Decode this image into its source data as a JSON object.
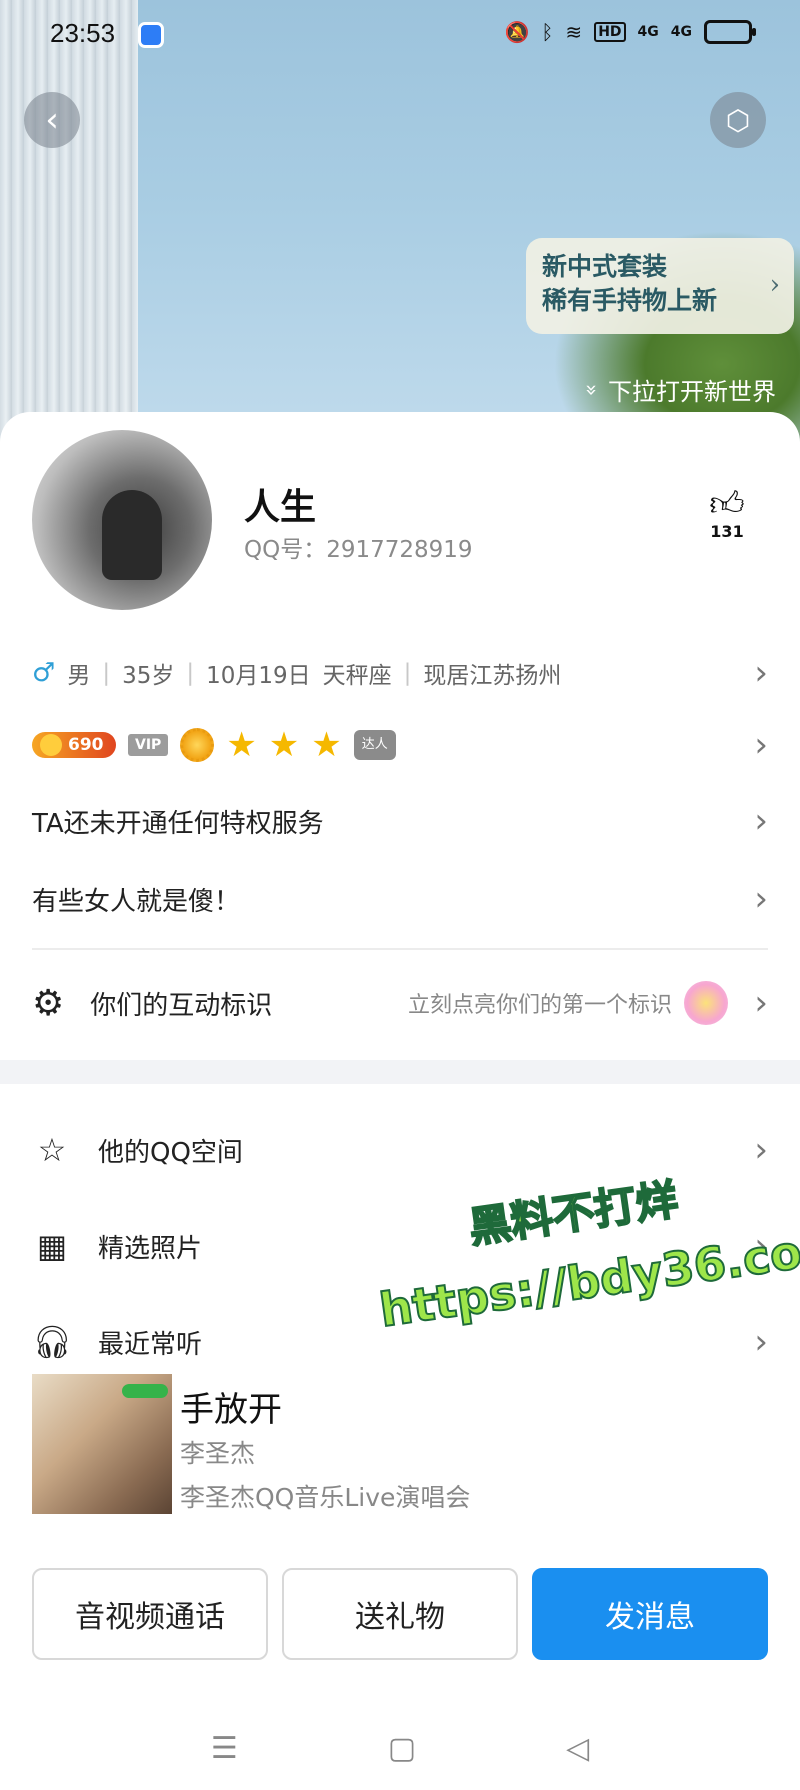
{
  "status_bar": {
    "time": "23:53",
    "icons": [
      "mute-icon",
      "bluetooth-icon",
      "wifi-icon",
      "hd-icon",
      "signal-4g-icon",
      "signal-4g-icon",
      "battery-icon"
    ],
    "hd": "HD",
    "net1": "4G",
    "net2": "4G"
  },
  "header": {
    "back_icon": "‹",
    "skin_icon": "⬡",
    "promo_line1": "新中式套装",
    "promo_line2": "稀有手持物上新",
    "promo_arrow": "›",
    "pull_hint": "下拉打开新世界"
  },
  "profile": {
    "nickname": "人生",
    "qq_number": "QQ号：2917728919",
    "like_count": "131",
    "gender_symbol": "♂",
    "gender": "男",
    "age": "35岁",
    "birthday": "10月19日",
    "zodiac": "天秤座",
    "location": "现居江苏扬州",
    "coin_level": "690",
    "vip_label": "VIP",
    "daren_label": "达人",
    "privilege": "TA还未开通任何特权服务",
    "signature": "有些女人就是傻！",
    "interaction_label": "你们的互动标识",
    "interaction_hint": "立刻点亮你们的第一个标识"
  },
  "menu": [
    {
      "label": "他的QQ空间",
      "icon": "star-outline-icon"
    },
    {
      "label": "精选照片",
      "icon": "grid-icon"
    },
    {
      "label": "最近常听",
      "icon": "headphones-icon"
    }
  ],
  "song": {
    "title": "手放开",
    "artist": "李圣杰",
    "album": "李圣杰QQ音乐Live演唱会"
  },
  "actions": {
    "call": "音视频通话",
    "gift": "送礼物",
    "message": "发消息"
  },
  "watermark": {
    "line1": "黑料不打烊",
    "line2": "https://bdy36.co"
  },
  "colors": {
    "accent": "#1a8ff0",
    "male": "#2f9fd6"
  }
}
